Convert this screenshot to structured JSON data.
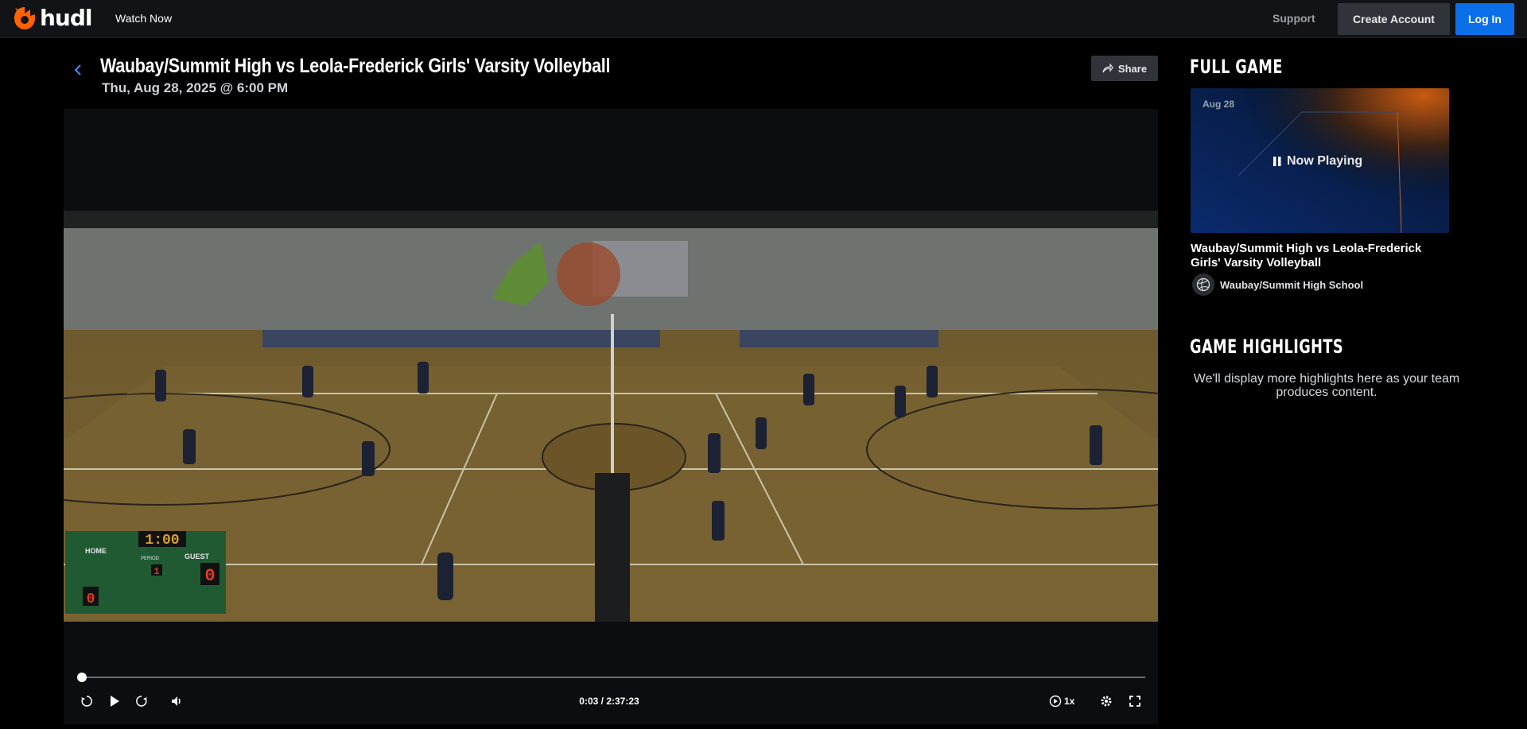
{
  "nav": {
    "logo_text": "hudl",
    "watch_now": "Watch Now",
    "support": "Support",
    "create_account": "Create Account",
    "log_in": "Log In",
    "accent_color": "#0a6fe8",
    "logo_color": "#ff6300"
  },
  "game": {
    "title": "Waubay/Summit High vs Leola-Frederick Girls' Varsity Volleyball",
    "date": "Thu, Aug 28, 2025 @ 6:00 PM",
    "share_label": "Share"
  },
  "player": {
    "time": "0:03 / 2:37:23",
    "speed": "1x",
    "progress": 0.0003,
    "scoreboard": {
      "clock": "1:00",
      "home_label": "HOME",
      "period_label": "PERIOD",
      "guest_label": "GUEST",
      "period": "1",
      "home_score": "0",
      "guest_score": "0"
    },
    "icons": [
      "rewind-10-icon",
      "play-icon",
      "forward-10-icon",
      "volume-icon",
      "playback-speed-icon",
      "settings-gear-icon",
      "fullscreen-icon"
    ]
  },
  "sidebar": {
    "full_game_heading": "FULL GAME",
    "thumb_date": "Aug 28",
    "now_playing": "Now Playing",
    "video_title": "Waubay/Summit High vs Leola-Frederick Girls' Varsity Volleyball",
    "school": "Waubay/Summit High School",
    "highlights_heading": "GAME HIGHLIGHTS",
    "highlights_message": "We'll display more highlights here as your team produces content."
  }
}
